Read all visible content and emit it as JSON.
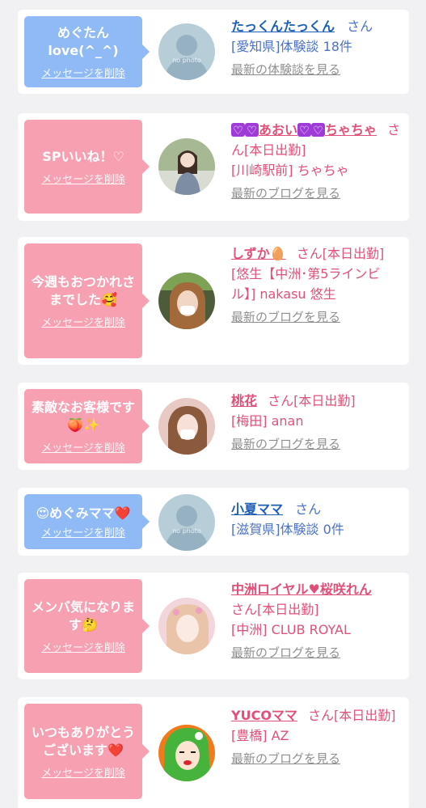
{
  "colors": {
    "background": "#f1f1f3",
    "card": "#ffffff",
    "bubble_blue": "#8fbaf6",
    "bubble_pink": "#f6a0b2",
    "link_blue": "#1c5fb6",
    "link_pink": "#e05078",
    "muted": "#8f8f8f"
  },
  "delete_label": "メッセージを削除",
  "cards": [
    {
      "bubble": "めぐたん\nlove(^_^)",
      "name": "たっくんたっくん",
      "suffix": "さん",
      "sub": "[愛知県]体験談 18件",
      "latest": "最新の体験談を見る",
      "avatar_icon": "no-photo-placeholder",
      "avatar_text": "no photo"
    },
    {
      "bubble": "SPいいね！♡",
      "name": "あおい",
      "name_tail": "ちゃちゃ",
      "suffix": "さん[本日出勤]",
      "sub": "[川崎駅前] ちゃちゃ",
      "latest": "最新のブログを見る",
      "avatar_icon": "profile-photo"
    },
    {
      "bubble": "今週もおつかれさまでした🥰",
      "name": "しずか🥚",
      "suffix": "さん[本日出勤]",
      "sub": "[悠生【中洲･第5ラインビル】] nakasu 悠生",
      "latest": "最新のブログを見る",
      "avatar_icon": "profile-photo"
    },
    {
      "bubble": "素敵なお客様です🍑✨",
      "name": "桃花",
      "suffix": "さん[本日出勤]",
      "sub": "[梅田] anan",
      "latest": "最新のブログを見る",
      "avatar_icon": "profile-photo"
    },
    {
      "bubble": "😍めぐみママ❤️",
      "name": "小夏ママ",
      "suffix": "さん",
      "sub": "[滋賀県]体験談 0件",
      "latest": "",
      "avatar_icon": "no-photo-placeholder",
      "avatar_text": "no photo"
    },
    {
      "bubble": "メンバ気になります🤔",
      "name": "中洲ロイヤル♥桜咲れん",
      "suffix": "さん[本日出勤]",
      "sub": "[中洲] CLUB ROYAL",
      "latest": "最新のブログを見る",
      "avatar_icon": "profile-photo"
    },
    {
      "bubble": "いつもありがとうございます❤️",
      "name": "YUCOママ",
      "suffix": "さん[本日出勤]",
      "sub": "[豊橋] AZ",
      "latest": "最新のブログを見る",
      "avatar_icon": "illustrated-avatar"
    }
  ]
}
